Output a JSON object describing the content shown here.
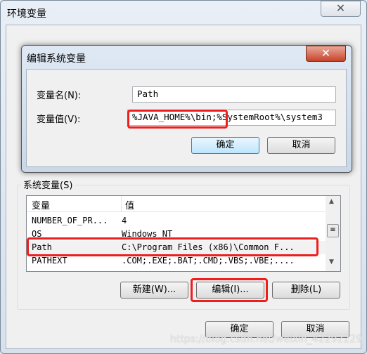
{
  "outer_window": {
    "title": "环境变量",
    "system_vars_group_label": "系统变量(S)",
    "list": {
      "columns": [
        "变量",
        "值"
      ],
      "rows": [
        {
          "name": "NUMBER_OF_PR...",
          "value": "4"
        },
        {
          "name": "OS",
          "value": "Windows_NT"
        },
        {
          "name": "Path",
          "value": "C:\\Program Files (x86)\\Common F..."
        },
        {
          "name": "PATHEXT",
          "value": ".COM;.EXE;.BAT;.CMD;.VBS;.VBE;...."
        }
      ]
    },
    "buttons": {
      "new": "新建(W)...",
      "edit": "编辑(I)...",
      "delete": "删除(L)",
      "ok": "确定",
      "cancel": "取消"
    }
  },
  "edit_dialog": {
    "title": "编辑系统变量",
    "name_label": "变量名(N):",
    "name_value": "Path",
    "value_label": "变量值(V):",
    "value_value": "%JAVA_HOME%\\bin;%SystemRoot%\\system3",
    "ok": "确定",
    "cancel": "取消"
  },
  "highlight_color": "#f01d1d",
  "watermark": "https://blog.csdn.net/weixin_42292229"
}
